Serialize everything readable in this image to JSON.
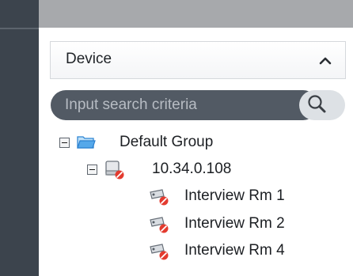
{
  "panel": {
    "title": "Device",
    "collapse_icon": "chevron-up-icon"
  },
  "search": {
    "placeholder": "Input search criteria",
    "button_icon": "search-icon"
  },
  "tree": {
    "group": {
      "label": "Default Group",
      "icon": "folder-open-icon",
      "expanded": true
    },
    "device": {
      "label": "10.34.0.108",
      "icon": "offline-device-icon",
      "expanded": true
    },
    "channels": [
      {
        "label": "Interview Rm 1",
        "icon": "offline-camera-icon"
      },
      {
        "label": "Interview Rm 2",
        "icon": "offline-camera-icon"
      },
      {
        "label": "Interview Rm 4",
        "icon": "offline-camera-icon"
      }
    ]
  },
  "colors": {
    "sidebar_dark": "#3c444d",
    "topbar_gray": "#a7a9ac",
    "search_pill": "#525a64",
    "status_red": "#e33b2f",
    "folder_blue": "#3c8fd8"
  }
}
